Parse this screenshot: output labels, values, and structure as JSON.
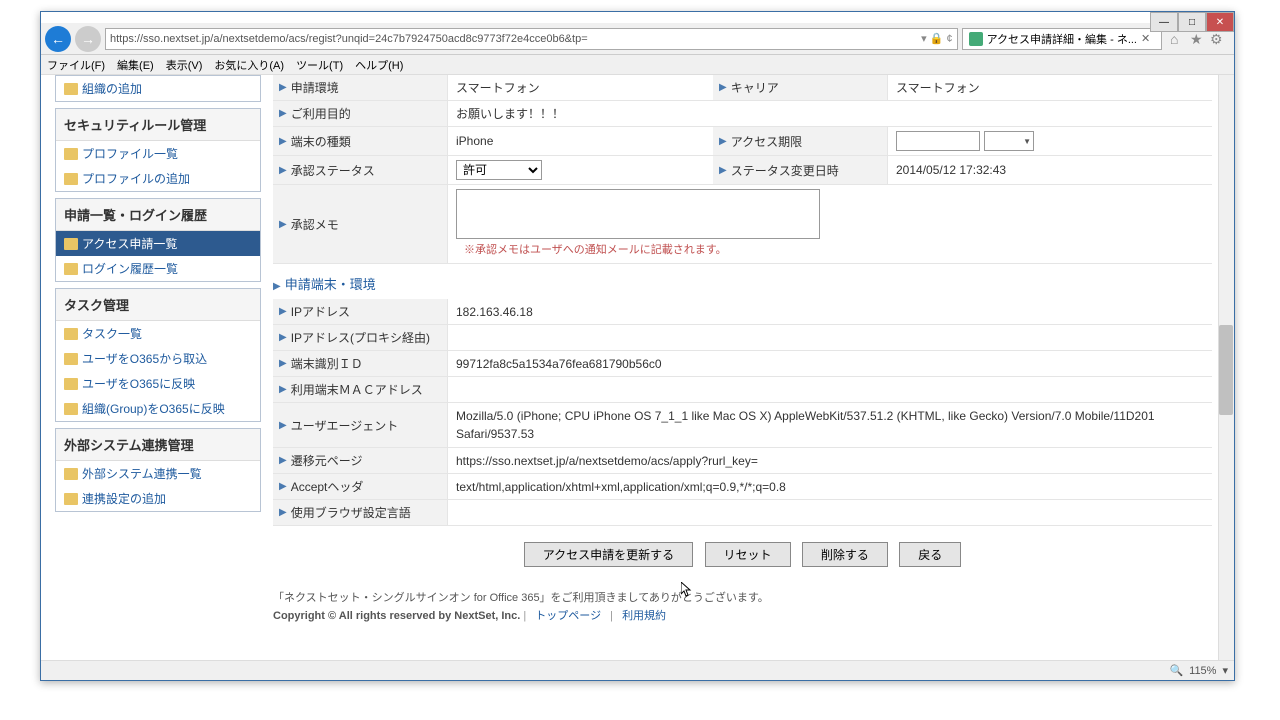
{
  "window": {
    "url": "https://sso.nextset.jp/a/nextsetdemo/acs/regist?unqid=24c7b7924750acd8c9773f72e4cce0b6&tp=",
    "tab_title": "アクセス申請詳細・編集 - ネ...",
    "zoom": "115%"
  },
  "menu": {
    "file": "ファイル(F)",
    "edit": "編集(E)",
    "view": "表示(V)",
    "fav": "お気に入り(A)",
    "tool": "ツール(T)",
    "help": "ヘルプ(H)"
  },
  "sidebar": {
    "box0": {
      "item0": "組織の追加"
    },
    "box1": {
      "header": "セキュリティルール管理",
      "item0": "プロファイル一覧",
      "item1": "プロファイルの追加"
    },
    "box2": {
      "header": "申請一覧・ログイン履歴",
      "item0": "アクセス申請一覧",
      "item1": "ログイン履歴一覧"
    },
    "box3": {
      "header": "タスク管理",
      "item0": "タスク一覧",
      "item1": "ユーザをO365から取込",
      "item2": "ユーザをO365に反映",
      "item3": "組織(Group)をO365に反映"
    },
    "box4": {
      "header": "外部システム連携管理",
      "item0": "外部システム連携一覧",
      "item1": "連携設定の追加"
    }
  },
  "form": {
    "env": {
      "label": "申請環境",
      "value": "スマートフォン"
    },
    "carrier": {
      "label": "キャリア",
      "value": "スマートフォン"
    },
    "purpose": {
      "label": "ご利用目的",
      "value": "お願いします！！！"
    },
    "device": {
      "label": "端末の種類",
      "value": "iPhone"
    },
    "period": {
      "label": "アクセス期限"
    },
    "status": {
      "label": "承認ステータス",
      "value": "許可"
    },
    "status_date": {
      "label": "ステータス変更日時",
      "value": "2014/05/12 17:32:43"
    },
    "memo": {
      "label": "承認メモ",
      "note": "※承認メモはユーザへの通知メールに記載されます。"
    },
    "section": "申請端末・環境",
    "ip": {
      "label": "IPアドレス",
      "value": "182.163.46.18"
    },
    "ip_proxy": {
      "label": "IPアドレス(プロキシ経由)"
    },
    "device_id": {
      "label": "端末識別ＩＤ",
      "value": "99712fa8c5a1534a76fea681790b56c0"
    },
    "mac": {
      "label": "利用端末ＭＡＣアドレス"
    },
    "ua": {
      "label": "ユーザエージェント",
      "value": "Mozilla/5.0 (iPhone; CPU iPhone OS 7_1_1 like Mac OS X) AppleWebKit/537.51.2 (KHTML, like Gecko) Version/7.0 Mobile/11D201 Safari/9537.53"
    },
    "referer": {
      "label": "遷移元ページ",
      "value": "https://sso.nextset.jp/a/nextsetdemo/acs/apply?rurl_key="
    },
    "accept": {
      "label": "Acceptヘッダ",
      "value": "text/html,application/xhtml+xml,application/xml;q=0.9,*/*;q=0.8"
    },
    "lang": {
      "label": "使用ブラウザ設定言語"
    }
  },
  "buttons": {
    "update": "アクセス申請を更新する",
    "reset": "リセット",
    "delete": "削除する",
    "back": "戻る"
  },
  "footer": {
    "line1": "「ネクストセット・シングルサインオン for Office 365」をご利用頂きましてありがとうございます。",
    "copyright": "Copyright © All rights reserved by NextSet, Inc.",
    "top": "トップページ",
    "terms": "利用規約"
  }
}
